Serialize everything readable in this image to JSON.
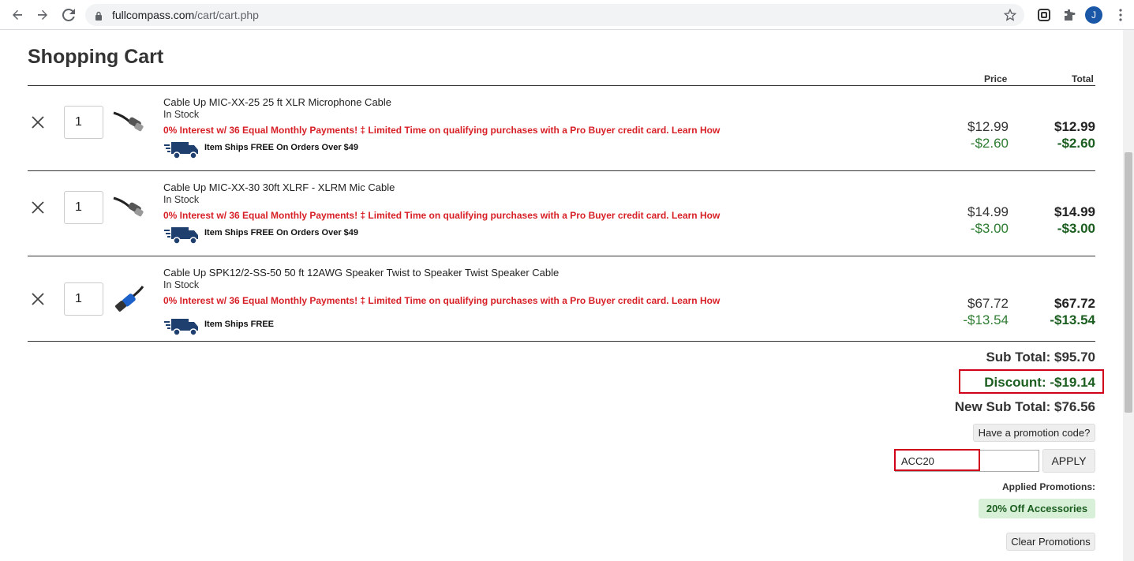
{
  "browser": {
    "url_host": "fullcompass.com",
    "url_path": "/cart/cart.php",
    "avatar_letter": "J"
  },
  "page": {
    "title": "Shopping Cart",
    "col_price": "Price",
    "col_total": "Total"
  },
  "items": [
    {
      "qty": "1",
      "name": "Cable Up MIC-XX-25 25 ft XLR Microphone Cable",
      "stock": "In Stock",
      "promo": "0% Interest w/ 36 Equal Monthly Payments! ‡ Limited Time on qualifying purchases with a Pro Buyer credit card. Learn How",
      "shipping": "Item Ships FREE On Orders Over $49",
      "price": "$12.99",
      "price_discount": "-$2.60",
      "total": "$12.99",
      "total_discount": "-$2.60",
      "thumb": "xlr-cable-icon"
    },
    {
      "qty": "1",
      "name": "Cable Up MIC-XX-30 30ft XLRF - XLRM Mic Cable",
      "stock": "In Stock",
      "promo": "0% Interest w/ 36 Equal Monthly Payments! ‡ Limited Time on qualifying purchases with a Pro Buyer credit card. Learn How",
      "shipping": "Item Ships FREE On Orders Over $49",
      "price": "$14.99",
      "price_discount": "-$3.00",
      "total": "$14.99",
      "total_discount": "-$3.00",
      "thumb": "xlr-cable-icon"
    },
    {
      "qty": "1",
      "name": "Cable Up SPK12/2-SS-50 50 ft 12AWG Speaker Twist to Speaker Twist Speaker Cable",
      "stock": "In Stock",
      "promo": "0% Interest w/ 36 Equal Monthly Payments! ‡ Limited Time on qualifying purchases with a Pro Buyer credit card. Learn How",
      "shipping": "Item Ships FREE",
      "price": "$67.72",
      "price_discount": "-$13.54",
      "total": "$67.72",
      "total_discount": "-$13.54",
      "thumb": "speaker-cable-icon"
    }
  ],
  "summary": {
    "subtotal": "Sub Total: $95.70",
    "discount": "Discount: -$19.14",
    "new_subtotal": "New Sub Total: $76.56",
    "promo_prompt": "Have a promotion code?",
    "promo_value": "ACC20",
    "apply_label": "APPLY",
    "applied_label": "Applied Promotions:",
    "applied_badge": "20% Off Accessories",
    "clear_label": "Clear Promotions"
  },
  "colors": {
    "promo_red": "#d71f26",
    "discount_green": "#1b5e20",
    "highlight_red": "#d0021b",
    "truck_navy": "#1f3f6e"
  }
}
